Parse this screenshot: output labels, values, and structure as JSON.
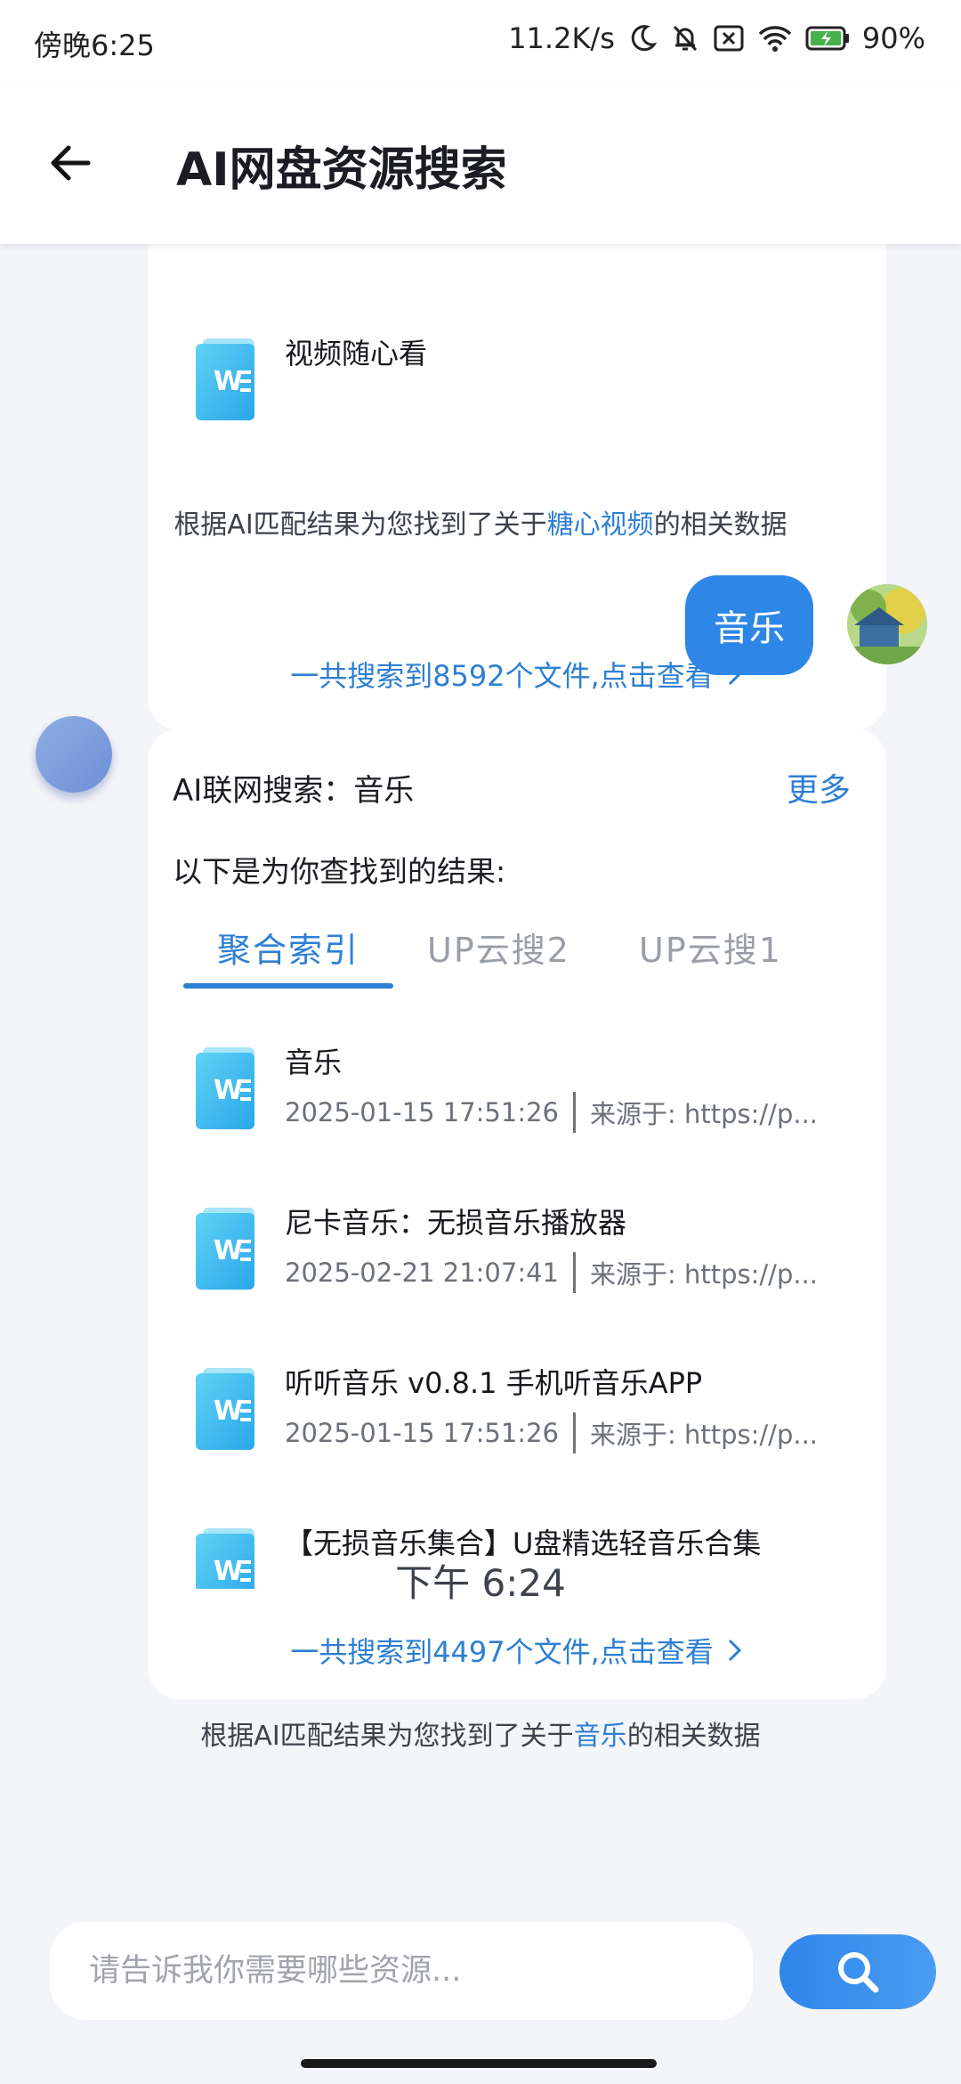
{
  "status_bar": {
    "time": "傍晚6:25",
    "network_speed": "11.2K/s",
    "battery": "90%",
    "icons": [
      "moon-icon",
      "bell-muted-icon",
      "sim-disabled-icon",
      "wifi-icon",
      "battery-charging-icon"
    ]
  },
  "header": {
    "title": "AI网盘资源搜索",
    "back_icon": "arrow-left-icon"
  },
  "previous_result": {
    "last_file": {
      "name": "视频随心看",
      "date": ""
    },
    "total_link": "一共搜索到8592个文件,点击查看",
    "note_prefix": "根据AI匹配结果为您找到了关于",
    "keyword": "糖心视频",
    "note_suffix": "的相关数据"
  },
  "user_message": {
    "text": "音乐"
  },
  "result_card": {
    "heading": "AI联网搜索：音乐",
    "more_label": "更多",
    "subtitle": "以下是为你查找到的结果:",
    "tabs": [
      {
        "label": "聚合索引",
        "active": true
      },
      {
        "label": "UP云搜2",
        "active": false
      },
      {
        "label": "UP云搜1",
        "active": false
      }
    ],
    "files": [
      {
        "name": "音乐",
        "date": "2025-01-15 17:51:26",
        "source": "来源于: https://p..."
      },
      {
        "name": "尼卡音乐：无损音乐播放器",
        "date": "2025-02-21 21:07:41",
        "source": "来源于: https://p..."
      },
      {
        "name": "听听音乐 v0.8.1 手机听音乐APP",
        "date": "2025-01-15 17:51:26",
        "source": "来源于: https://p..."
      },
      {
        "name": "【无损音乐集合】U盘精选轻音乐合集",
        "date": "",
        "source": ""
      }
    ],
    "total_link": "一共搜索到4497个文件,点击查看",
    "note_prefix": "根据AI匹配结果为您找到了关于",
    "keyword": "音乐",
    "note_suffix": "的相关数据"
  },
  "timestamp": "下午 6:24",
  "input": {
    "placeholder": "请告诉我你需要哪些资源...",
    "value": ""
  },
  "colors": {
    "accent": "#2d7fd3",
    "bubble": "#2e86e6",
    "background": "#f4f5f8"
  }
}
